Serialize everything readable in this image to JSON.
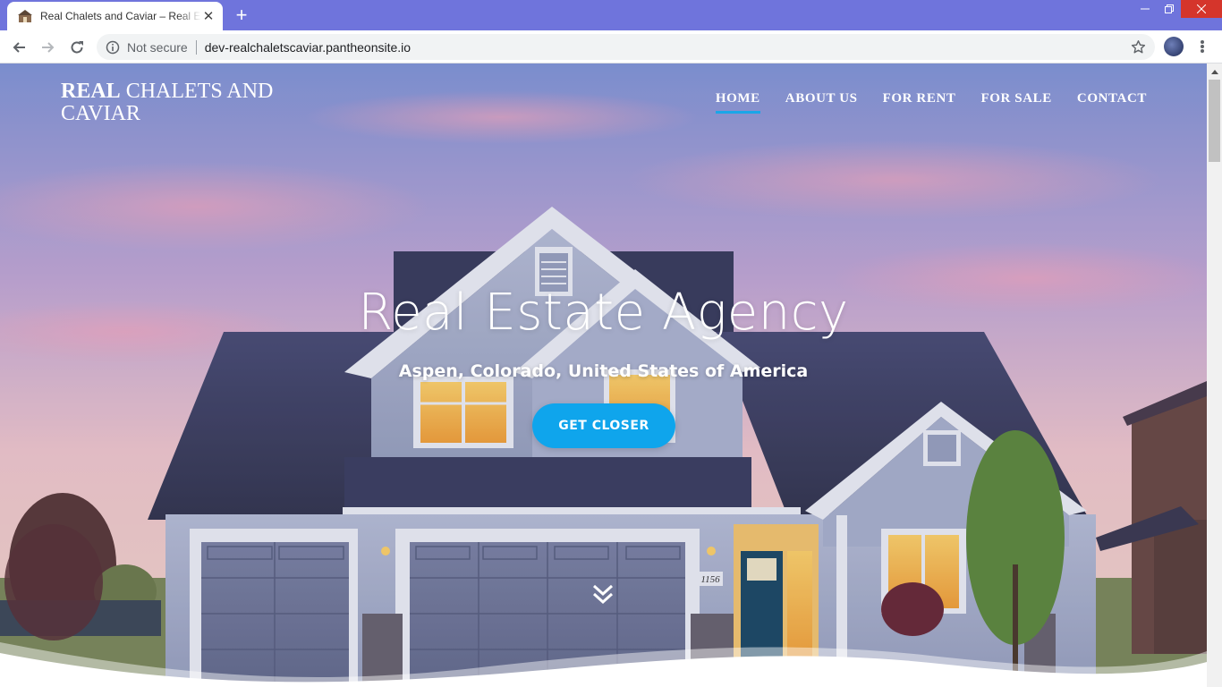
{
  "browser": {
    "tab_title": "Real Chalets and Caviar – Real Estate Agency",
    "security_label": "Not secure",
    "url": "dev-realchaletscaviar.pantheonsite.io"
  },
  "site": {
    "logo_bold": "Real",
    "logo_rest": "Chalets and Caviar",
    "nav": {
      "home": "Home",
      "about": "About Us",
      "rent": "For Rent",
      "sale": "For Sale",
      "contact": "Contact"
    },
    "active_nav": "home"
  },
  "hero": {
    "title": "Real Estate Agency",
    "subtitle": "Aspen, Colorado, United States of America",
    "cta_label": "GET CLOSER",
    "house_number": "1156"
  },
  "colors": {
    "accent": "#0fa5ec",
    "titlebar": "#6f74dc"
  },
  "icons": {
    "favicon": "house-favicon-icon",
    "scroll": "double-chevron-down-icon"
  }
}
